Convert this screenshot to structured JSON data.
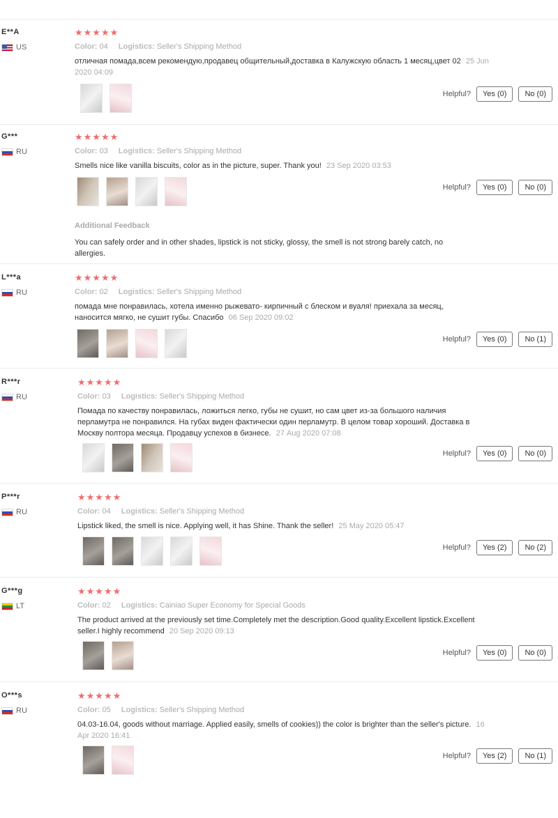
{
  "helpful_label": "Helpful?",
  "colors": {
    "star": "#f06d6d",
    "divider": "#ececec"
  },
  "reviews": [
    {
      "user": "E**A",
      "country": "US",
      "flag": "us",
      "stars": "★★★★★",
      "color_label": "Color:",
      "color_value": "04",
      "logistics_label": "Logistics:",
      "logistics_value": "Seller's Shipping Method",
      "text": "отличная помада,всем рекомендую,продавец общительный,доставка в Калужскую область 1 месяц,цвет 02",
      "date": "25 Jun 2020 04:09",
      "photos": 2,
      "yes": "Yes (0)",
      "no": "No (0)"
    },
    {
      "user": "G***",
      "country": "RU",
      "flag": "ru",
      "stars": "★★★★★",
      "color_label": "Color:",
      "color_value": "03",
      "logistics_label": "Logistics:",
      "logistics_value": "Seller's Shipping Method",
      "text": "Smells nice like vanilla biscuits, color as in the picture, super. Thank you!",
      "date": "23 Sep 2020 03:53",
      "photos": 4,
      "yes": "Yes (0)",
      "no": "No (0)",
      "additional_title": "Additional Feedback",
      "additional_text": "You can safely order and in other shades, lipstick is not sticky, glossy, the smell is not strong barely catch, no allergies."
    },
    {
      "user": "L***a",
      "country": "RU",
      "flag": "ru",
      "stars": "★★★★★",
      "color_label": "Color:",
      "color_value": "02",
      "logistics_label": "Logistics:",
      "logistics_value": "Seller's Shipping Method",
      "text": "помада мне понравилась, хотела именно рыжевато- кирпичный с блеском и вуаля! приехала за месяц, наносится мягко, не сушит губы. Спасибо",
      "date": "06 Sep 2020 09:02",
      "photos": 4,
      "yes": "Yes (0)",
      "no": "No (1)"
    },
    {
      "user": "R***r",
      "country": "RU",
      "flag": "ru",
      "stars": "★★★★★",
      "color_label": "Color:",
      "color_value": "03",
      "logistics_label": "Logistics:",
      "logistics_value": "Seller's Shipping Method",
      "text": "Помада по качеству понравилась, ложиться легко, губы не сушит, но сам цвет из-за большого наличия перламутра не понравился. На губах виден фактически один перламутр. В целом товар хороший. Доставка в Москву полтора месяца. Продавцу успехов в бизнесе.",
      "date": "27 Aug 2020 07:08",
      "photos": 4,
      "yes": "Yes (0)",
      "no": "No (0)"
    },
    {
      "user": "P***r",
      "country": "RU",
      "flag": "ru",
      "stars": "★★★★★",
      "color_label": "Color:",
      "color_value": "04",
      "logistics_label": "Logistics:",
      "logistics_value": "Seller's Shipping Method",
      "text": "Lipstick liked, the smell is nice. Applying well, it has Shine. Thank the seller!",
      "date": "25 May 2020 05:47",
      "photos": 5,
      "yes": "Yes (2)",
      "no": "No (2)"
    },
    {
      "user": "G***g",
      "country": "LT",
      "flag": "lt",
      "stars": "★★★★★",
      "color_label": "Color:",
      "color_value": "02",
      "logistics_label": "Logistics:",
      "logistics_value": "Cainiao Super Economy for Special Goods",
      "text": "The product arrived at the previously set time.Completely met the description.Good quality.Excellent lipstick.Excellent seller.I highly recommend",
      "date": "20 Sep 2020 09:13",
      "photos": 2,
      "yes": "Yes (0)",
      "no": "No (0)"
    },
    {
      "user": "O***s",
      "country": "RU",
      "flag": "ru",
      "stars": "★★★★★",
      "color_label": "Color:",
      "color_value": "05",
      "logistics_label": "Logistics:",
      "logistics_value": "Seller's Shipping Method",
      "text": "04.03-16.04, goods without marriage. Applied easily, smells of cookies)) the color is brighter than the seller's picture.",
      "date": "16 Apr 2020 16:41",
      "photos": 2,
      "yes": "Yes (2)",
      "no": "No (1)"
    }
  ]
}
